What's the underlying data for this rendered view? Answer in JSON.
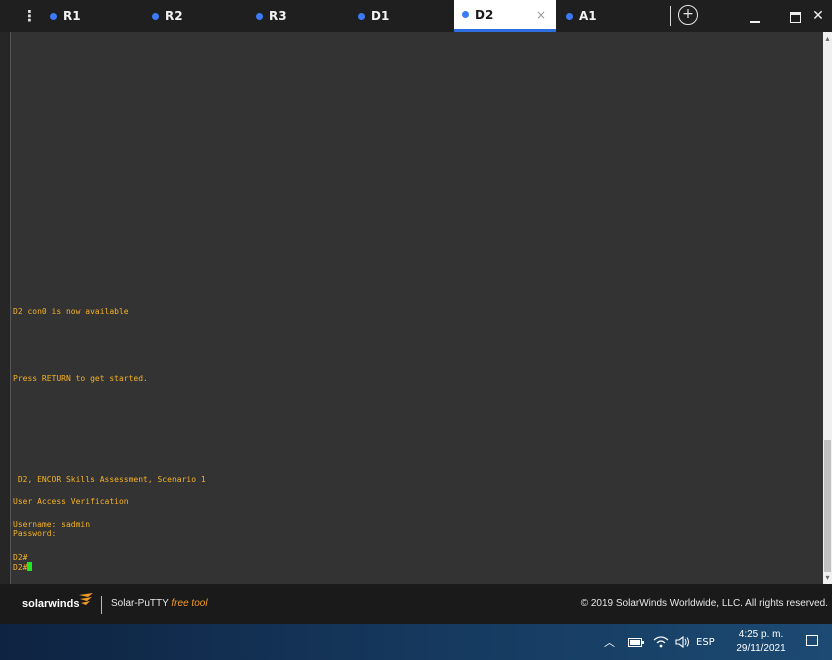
{
  "tabs": [
    {
      "label": "R1",
      "active": false
    },
    {
      "label": "R2",
      "active": false
    },
    {
      "label": "R3",
      "active": false
    },
    {
      "label": "D1",
      "active": false
    },
    {
      "label": "D2",
      "active": true
    },
    {
      "label": "A1",
      "active": false
    }
  ],
  "tab_close_glyph": "×",
  "add_tab_glyph": "+",
  "terminal": {
    "lines": [
      "D2 con0 is now available",
      "Press RETURN to get started.",
      " D2, ENCOR Skills Assessment, Scenario 1",
      "User Access Verification",
      "Username: sadmin",
      "Password:",
      "D2#",
      "D2#"
    ]
  },
  "footer": {
    "brand": "solarwinds",
    "product": "Solar-PuTTY",
    "product_tag": "free tool",
    "copyright": "© 2019 SolarWinds Worldwide, LLC. All rights reserved."
  },
  "taskbar": {
    "lang": "ESP",
    "time": "4:25 p. m.",
    "date": "29/11/2021"
  },
  "colors": {
    "terminal_bg": "#333333",
    "terminal_text": "#f5b223",
    "cursor": "#22e622",
    "tab_dot": "#3b7bf6",
    "accent": "#2e6fe0"
  }
}
